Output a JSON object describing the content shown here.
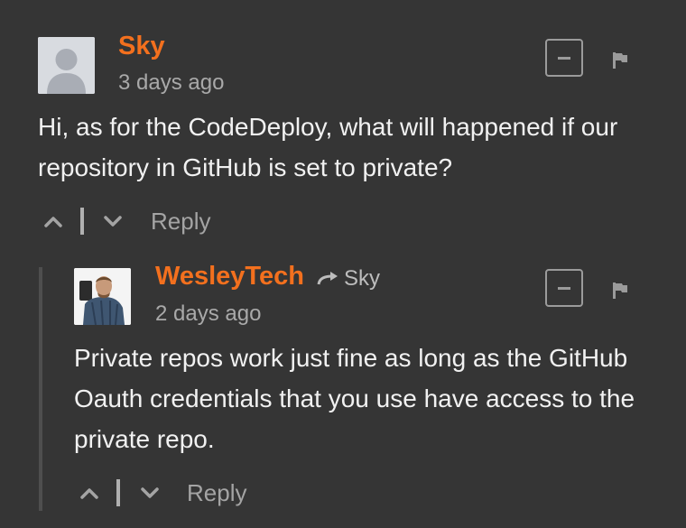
{
  "comments": [
    {
      "author": "Sky",
      "time": "3 days ago",
      "text": "Hi, as for the CodeDeploy, what will happened if our repository in GitHub is set to private?",
      "reply_label": "Reply",
      "avatar": "default-avatar"
    },
    {
      "author": "WesleyTech",
      "reply_to": "Sky",
      "time": "2 days ago",
      "text": "Private repos work just fine as long as the GitHub Oauth credentials that you use have access to the private repo.",
      "reply_label": "Reply",
      "avatar": "user-photo-avatar"
    }
  ],
  "icons": {
    "collapse": "minus-square-icon",
    "flag": "flag-icon",
    "upvote": "chevron-up-icon",
    "downvote": "chevron-down-icon",
    "reply_arrow": "arrow-right-icon"
  },
  "colors": {
    "background": "#353535",
    "author": "#f3701e",
    "text": "#f1f1f1",
    "muted": "#a9a9a9"
  }
}
